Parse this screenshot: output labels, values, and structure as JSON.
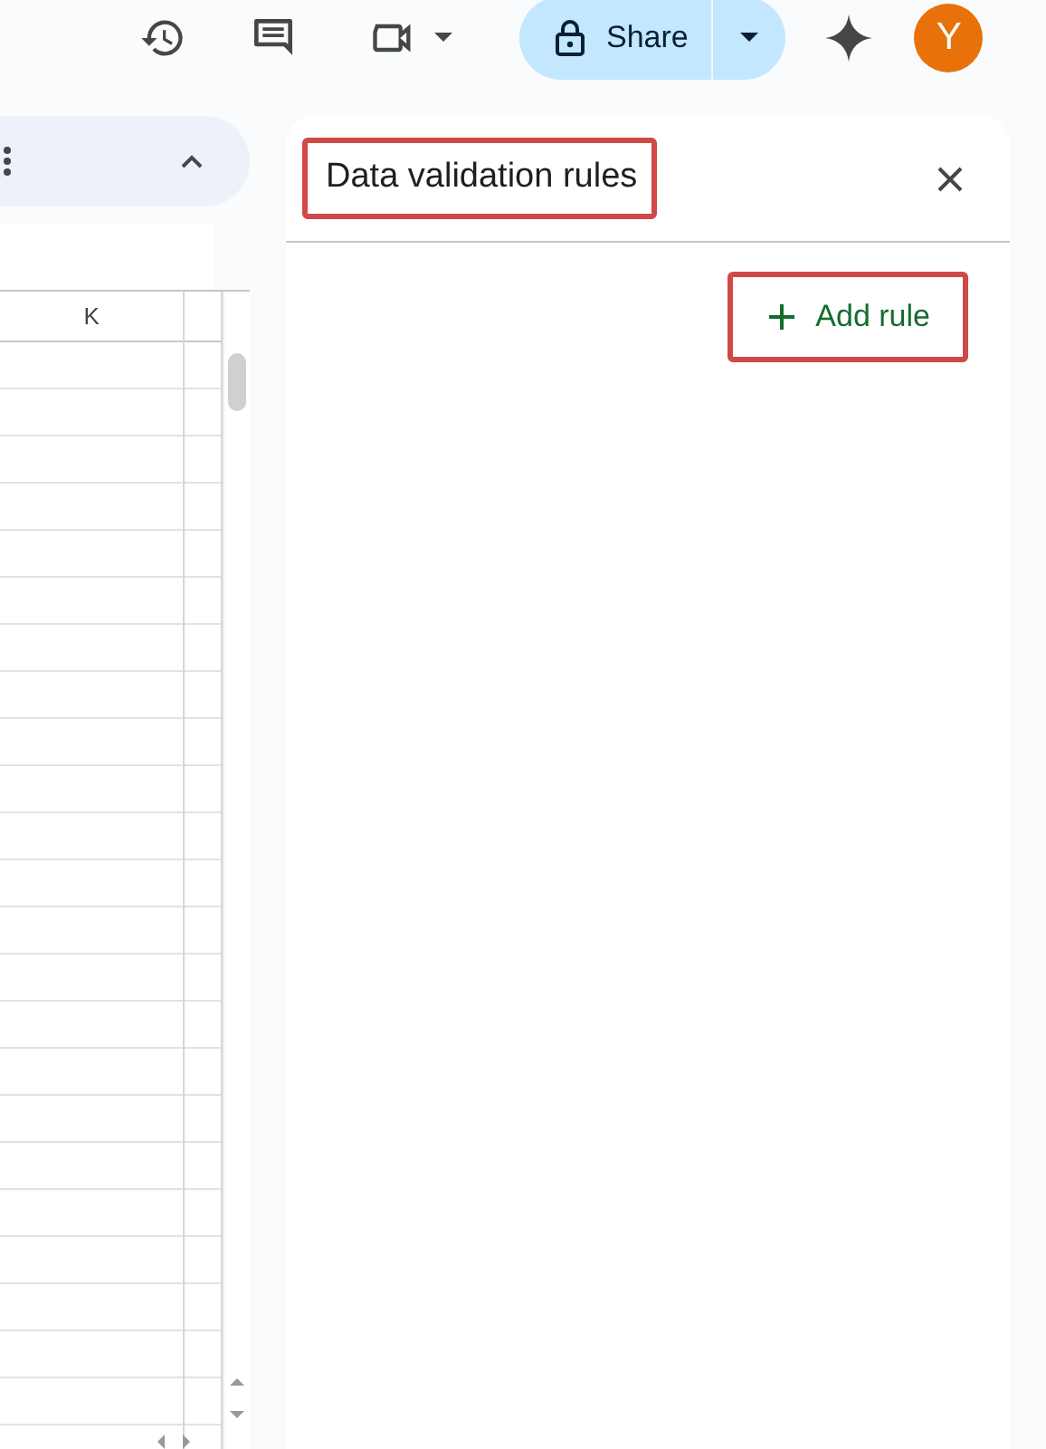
{
  "top_bar": {
    "share_label": "Share",
    "avatar_letter": "Y"
  },
  "sheet": {
    "column_header": "K"
  },
  "panel": {
    "title": "Data validation rules",
    "title_highlighted": true,
    "add_button": {
      "label": "Add rule",
      "highlighted": true
    }
  }
}
